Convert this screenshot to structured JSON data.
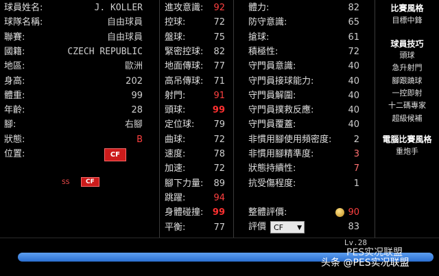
{
  "profile": {
    "rows": [
      {
        "label": "球員姓名:",
        "value": "J. KOLLER",
        "mono": true
      },
      {
        "label": "球隊名稱:",
        "value": "自由球員"
      },
      {
        "label": "聯賽:",
        "value": "自由球員"
      },
      {
        "label": "國籍:",
        "value": "CZECH REPUBLIC",
        "mono": true
      },
      {
        "label": "地區:",
        "value": "歐洲"
      },
      {
        "label": "身高:",
        "value": "202"
      },
      {
        "label": "體重:",
        "value": "99"
      },
      {
        "label": "年齡:",
        "value": "28"
      },
      {
        "label": "腳:",
        "value": "右腳"
      },
      {
        "label": "狀態:",
        "value": "B"
      },
      {
        "label": "位置:",
        "value": "CF"
      }
    ],
    "positions": [
      "SS",
      "CF"
    ]
  },
  "attrs_col1": [
    {
      "label": "進攻意識:",
      "value": "92",
      "style": "red"
    },
    {
      "label": "控球:",
      "value": "72"
    },
    {
      "label": "盤球:",
      "value": "75"
    },
    {
      "label": "緊密控球:",
      "value": "82"
    },
    {
      "label": "地面傳球:",
      "value": "77"
    },
    {
      "label": "高吊傳球:",
      "value": "71"
    },
    {
      "label": "射門:",
      "value": "91",
      "style": "red"
    },
    {
      "label": "頭球:",
      "value": "99",
      "style": "bold"
    },
    {
      "label": "定位球:",
      "value": "79"
    },
    {
      "label": "曲球:",
      "value": "72"
    },
    {
      "label": "速度:",
      "value": "78"
    },
    {
      "label": "加速:",
      "value": "72"
    },
    {
      "label": "腳下力量:",
      "value": "89"
    },
    {
      "label": "跳躍:",
      "value": "94",
      "style": "red"
    },
    {
      "label": "身體碰撞:",
      "value": "99",
      "style": "bold"
    },
    {
      "label": "平衡:",
      "value": "77"
    }
  ],
  "attrs_col2": [
    {
      "label": "體力:",
      "value": "82"
    },
    {
      "label": "防守意識:",
      "value": "65"
    },
    {
      "label": "搶球:",
      "value": "61"
    },
    {
      "label": "積極性:",
      "value": "72"
    },
    {
      "label": "守門員意識:",
      "value": "40"
    },
    {
      "label": "守門員接球能力:",
      "value": "40"
    },
    {
      "label": "守門員解圍:",
      "value": "40"
    },
    {
      "label": "守門員撲救反應:",
      "value": "40"
    },
    {
      "label": "守門員覆蓋:",
      "value": "40"
    },
    {
      "label": "非慣用腳使用頻密度:",
      "value": "2"
    },
    {
      "label": "非慣用腳精準度:",
      "value": "3",
      "style": "pink"
    },
    {
      "label": "狀態持續性:",
      "value": "7",
      "style": "pink"
    },
    {
      "label": "抗受傷程度:",
      "value": "1"
    }
  ],
  "overall": {
    "label": "整體評價:",
    "value": "90"
  },
  "rating": {
    "label": "評價",
    "selected": "CF",
    "value": "83"
  },
  "side": {
    "style_title": "比賽風格",
    "style_items": [
      "目標中鋒"
    ],
    "skills_title": "球員技巧",
    "skills_items": [
      "頭球",
      "急升射門",
      "腳跟蹺球",
      "一控即射",
      "十二碼專家",
      "超級候補"
    ],
    "com_title": "電腦比賽風格",
    "com_items": [
      "重炮手"
    ]
  },
  "footer": {
    "level": "Lv.28",
    "progress": 1.0,
    "watermark": "头条 @PES实况联盟",
    "watermark_back": "PES实况联盟"
  }
}
